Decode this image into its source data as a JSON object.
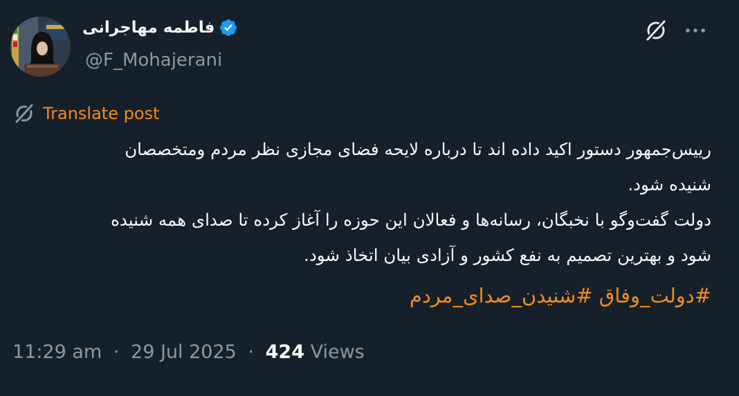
{
  "author": {
    "display_name": "فاطمه مهاجرانی",
    "handle": "@F_Mohajerani",
    "verified": true
  },
  "actions": {
    "grok_icon": "grok-icon",
    "more_icon": "more-horizontal-icon"
  },
  "translate": {
    "label": "Translate post",
    "icon": "grok-icon"
  },
  "post": {
    "lines": [
      "رییس‌جمهور دستور اکید داده اند تا درباره لایحه فضای مجازی نظر مردم و‌متخصصان",
      "شنیده شود.",
      "دولت گفت‌وگو با نخبگان، رسانه‌ها و فعالان این حوزه را آغاز کرده تا صدای همه شنیده",
      "شود و بهترین تصمیم به نفع کشور و آزادی بیان اتخاذ شود."
    ],
    "hashtags": [
      "#دولت_وفاق",
      "#شنیدن_صدای_مردم"
    ]
  },
  "meta": {
    "time": "11:29 am",
    "separator": "·",
    "date": "29 Jul 2025",
    "views_count": "424",
    "views_label": "Views"
  },
  "colors": {
    "background": "#15202b",
    "text": "#f7f9f9",
    "secondary": "#8b98a5",
    "accent": "#f28b1d",
    "verified": "#1d9bf0"
  }
}
